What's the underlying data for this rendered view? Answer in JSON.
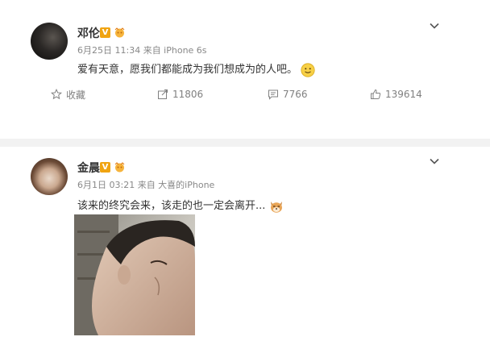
{
  "posts": [
    {
      "user_name": "邓伦",
      "verified_badge": "V",
      "meta": "6月25日 11:34 来自 iPhone 6s",
      "content": "爱有天意，愿我们都能成为我们想成为的人吧。",
      "emoji": "smile-emoji",
      "actions": {
        "favorite_label": "收藏",
        "share_count": "11806",
        "comment_count": "7766",
        "like_count": "139614"
      }
    },
    {
      "user_name": "金晨",
      "verified_badge": "V",
      "meta": "6月1日 03:21 来自 大喜的iPhone",
      "content": "该来的终究会来，该走的也一定会离开...",
      "emoji": "dog-emoji"
    }
  ],
  "colors": {
    "badge_orange": "#f0a412",
    "meta_gray": "#888888",
    "action_gray": "#808080",
    "divider": "#f2f2f2"
  }
}
